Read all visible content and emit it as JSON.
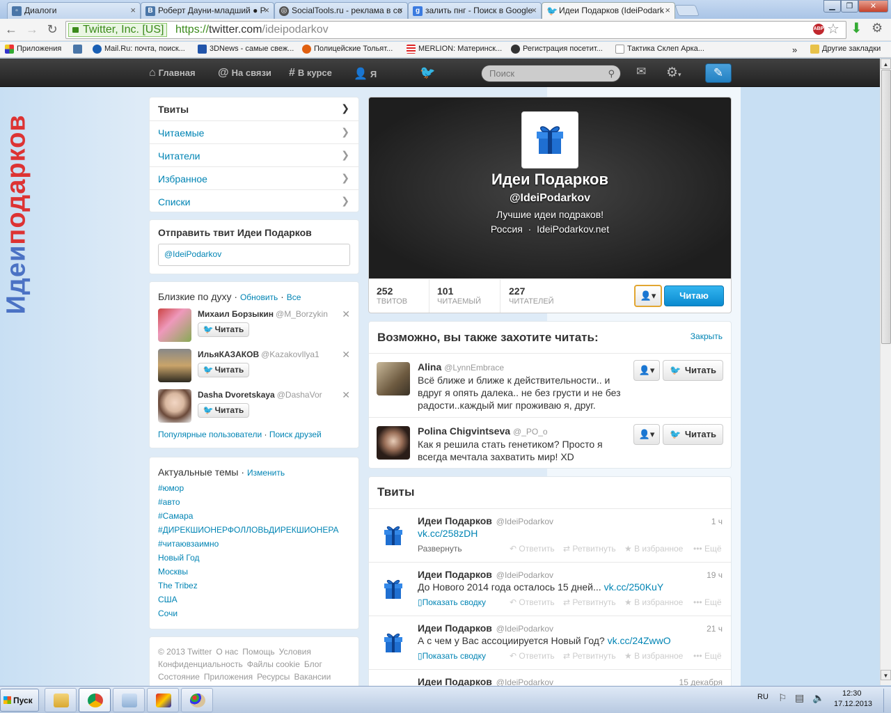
{
  "browser": {
    "tabs": [
      {
        "title": "Диалоги",
        "active": false,
        "icon": "vk-icon"
      },
      {
        "title": "Роберт Дауни-младший ● Р",
        "active": false,
        "icon": "vk-icon"
      },
      {
        "title": "SocialTools.ru - реклама в со",
        "active": false,
        "icon": "socialtools-icon"
      },
      {
        "title": "залить пнг - Поиск в Google",
        "active": false,
        "icon": "google-icon"
      },
      {
        "title": "Идеи Подарков (IdeiPodark",
        "active": true,
        "icon": "twitter-icon"
      }
    ],
    "ev_label": "Twitter, Inc. [US]",
    "url_scheme": "https://",
    "url_host": "twitter.com",
    "url_path": "/ideipodarkov",
    "abp_label": "ABP",
    "bookmarks": [
      "Приложения",
      "",
      "Mail.Ru: почта, поиск...",
      "3DNews - самые свеж...",
      "Полицейские Тольят...",
      "MERLION: Материнск...",
      "Регистрация посетит...",
      "Тактика Склеп Арка..."
    ],
    "bookmarks_more": "»",
    "bookmarks_other": "Другие закладки"
  },
  "topbar": {
    "home": "Главная",
    "connect": "На связи",
    "discover": "В курсе",
    "me": "Я",
    "search_placeholder": "Поиск"
  },
  "side_text": {
    "part1": "Идеи",
    "part2": "подарков"
  },
  "nav": [
    {
      "label": "Твиты",
      "selected": true
    },
    {
      "label": "Читаемые",
      "selected": false
    },
    {
      "label": "Читатели",
      "selected": false
    },
    {
      "label": "Избранное",
      "selected": false
    },
    {
      "label": "Списки",
      "selected": false
    }
  ],
  "send_tweet": {
    "title": "Отправить твит Идеи Подарков",
    "value": "@IdeiPodarkov"
  },
  "who_to_follow": {
    "title": "Близкие по духу",
    "refresh": "Обновить",
    "all": "Все",
    "follow_label": "Читать",
    "users": [
      {
        "name": "Михаил Борзыкин",
        "handle": "@M_Borzykin"
      },
      {
        "name": "ИльяКАЗАКОВ",
        "handle": "@KazakovIlya1"
      },
      {
        "name": "Dasha Dvoretskaya",
        "handle": "@DashaVor"
      }
    ],
    "popular": "Популярные пользователи",
    "find_friends": "Поиск друзей"
  },
  "trends": {
    "title": "Актуальные темы",
    "change": "Изменить",
    "items": [
      "#юмор",
      "#авто",
      "#Самара",
      "#ДИРЕКШИОНЕРФОЛЛОВЬДИРЕКШИОНЕРА",
      "#читаювзаимно",
      "Новый Год",
      "Москвы",
      "The Tribez",
      "США",
      "Сочи"
    ]
  },
  "footer": {
    "row1": [
      "© 2013 Twitter",
      "О нас",
      "Помощь",
      "Условия"
    ],
    "row2": [
      "Конфиденциальность",
      "Файлы cookie",
      "Блог"
    ],
    "row3": [
      "Состояние",
      "Приложения",
      "Ресурсы",
      "Вакансии"
    ]
  },
  "profile": {
    "name": "Идеи Подарков",
    "handle": "@IdeiPodarkov",
    "bio": "Лучшие идеи подраков!",
    "location": "Россия",
    "url": "IdeiPodarkov.net",
    "stats": [
      {
        "value": "252",
        "label": "ТВИТОВ"
      },
      {
        "value": "101",
        "label": "ЧИТАЕМЫЙ"
      },
      {
        "value": "227",
        "label": "ЧИТАТЕЛЕЙ"
      }
    ],
    "following_label": "Читаю"
  },
  "suggestions": {
    "title": "Возможно, вы также захотите читать:",
    "close": "Закрыть",
    "follow_label": "Читать",
    "users": [
      {
        "name": "Alina",
        "handle": "@LynnEmbrace",
        "bio": "Всё ближе и ближе к действительности.. и вдруг я опять далека.. не без грусти и не без радости..каждый миг проживаю я, друг."
      },
      {
        "name": "Polina Chigvintseva",
        "handle": "@_PO_o",
        "bio": "Как я решила стать генетиком?  Просто я всегда мечтала захватить мир! XD"
      }
    ]
  },
  "tweets": {
    "title": "Твиты",
    "actions": {
      "reply": "Ответить",
      "retweet": "Ретвитнуть",
      "favorite": "В избранное",
      "more": "Ещё"
    },
    "items": [
      {
        "name": "Идеи Подарков",
        "handle": "@IdeiPodarkov",
        "time": "1 ч",
        "text": "",
        "link": "vk.cc/258zDH",
        "expand": "Развернуть"
      },
      {
        "name": "Идеи Подарков",
        "handle": "@IdeiPodarkov",
        "time": "19 ч",
        "text": "До Нового 2014 года осталось 15 дней... ",
        "link": "vk.cc/250KuY",
        "expand": "Показать сводку"
      },
      {
        "name": "Идеи Подарков",
        "handle": "@IdeiPodarkov",
        "time": "21 ч",
        "text": "А с чем у Вас ассоциируется Новый Год? ",
        "link": "vk.cc/24ZwwO",
        "expand": "Показать сводку"
      },
      {
        "name": "Идеи Подарков",
        "handle": "@IdeiPodarkov",
        "time": "15 декабря",
        "text": "",
        "link": "",
        "expand": ""
      }
    ]
  },
  "taskbar": {
    "start": "Пуск",
    "lang": "RU",
    "time": "12:30",
    "date": "17.12.2013"
  }
}
